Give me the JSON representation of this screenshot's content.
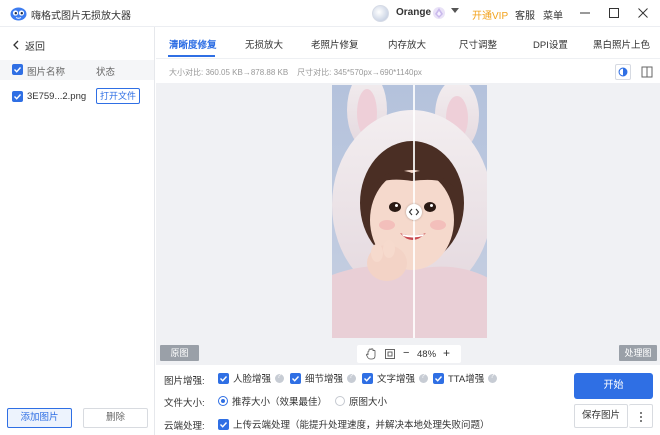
{
  "titlebar": {
    "app_title": "嗨格式图片无损放大器",
    "user_name": "Orange",
    "vip_label": "开通VIP",
    "service_label": "客服",
    "menu_label": "菜单"
  },
  "sidebar": {
    "back_label": "返回",
    "header": {
      "name_col": "图片名称",
      "status_col": "状态"
    },
    "files": [
      {
        "name": "3E759...2.png",
        "action_label": "打开文件"
      }
    ],
    "add_button": "添加图片",
    "delete_button": "删除"
  },
  "tabs": {
    "items": [
      "清晰度修复",
      "无损放大",
      "老照片修复",
      "内存放大",
      "尺寸调整",
      "DPI设置",
      "黑白照片上色"
    ],
    "active_index": 0
  },
  "info": {
    "size_label": "大小对比:",
    "size_value": "360.05 KB→878.88 KB",
    "dim_label": "尺寸对比:",
    "dim_value": "345*570px→690*1140px"
  },
  "canvas": {
    "original_label": "原图",
    "processed_label": "处理图",
    "zoom_minus": "−",
    "zoom_level": "48%",
    "zoom_plus": "+",
    "split_position": 0.5
  },
  "options": {
    "enhance_label": "图片增强:",
    "enhance_items": [
      {
        "label": "人脸增强",
        "checked": true
      },
      {
        "label": "细节增强",
        "checked": true
      },
      {
        "label": "文字增强",
        "checked": true
      },
      {
        "label": "TTA增强",
        "checked": true
      }
    ],
    "file_size_label": "文件大小:",
    "file_size_options": [
      {
        "label": "推荐大小（效果最佳）",
        "selected": true
      },
      {
        "label": "原图大小",
        "selected": false
      }
    ],
    "cloud_label": "云端处理:",
    "cloud_option": "上传云端处理（能提升处理速度，并解决本地处理失败问题）",
    "cloud_checked": true,
    "start_button": "开始",
    "save_button": "保存图片"
  },
  "colors": {
    "accent": "#2f6fe4",
    "vip": "#f2a21b",
    "badge_gray": "#9aa0a8"
  }
}
